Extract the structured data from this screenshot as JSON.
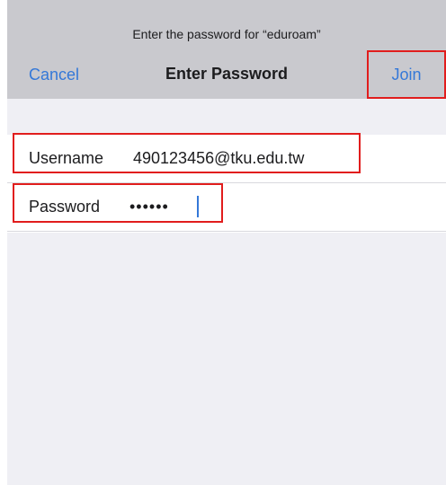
{
  "header": {
    "prompt": "Enter the password for “eduroam”",
    "title": "Enter Password",
    "cancel_label": "Cancel",
    "join_label": "Join"
  },
  "form": {
    "username": {
      "label": "Username",
      "value": "490123456@tku.edu.tw"
    },
    "password": {
      "label": "Password",
      "value": "••••••"
    }
  },
  "colors": {
    "accent": "#3478d8",
    "header_bg": "#c9c9ce",
    "highlight": "#e11d1d",
    "grouped_bg": "#efeff4"
  }
}
